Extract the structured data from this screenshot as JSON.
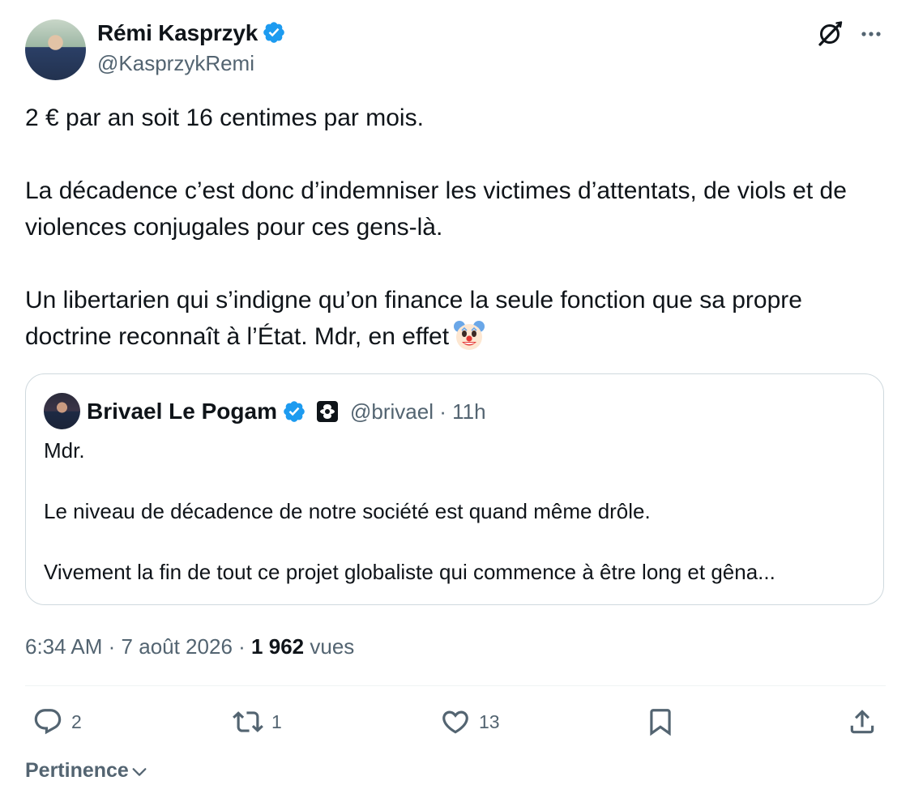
{
  "author": {
    "name": "Rémi Kasprzyk",
    "handle": "@KasprzykRemi"
  },
  "tweet_text": "2 € par an soit 16 centimes par mois.\n\nLa décadence c’est donc d’indemniser les victimes d’attentats, de viols et de violences conjugales pour ces gens-là.\n\nUn libertarien qui s’indigne qu’on finance la seule fonction que sa propre doctrine reconnaît à l’État. Mdr, en effet",
  "quoted": {
    "name": "Brivael Le Pogam",
    "handle": "@brivael",
    "separator": "·",
    "time": "11h",
    "text": "Mdr.\n\nLe niveau de décadence de notre société est quand même drôle.\n\nVivement la fin de tout ce projet globaliste qui commence à être long et gêna..."
  },
  "meta": {
    "time": "6:34 AM",
    "date": "7 août 2026",
    "separator": "·",
    "views_count": "1 962",
    "views_label": "vues"
  },
  "actions": {
    "reply_count": "2",
    "retweet_count": "1",
    "like_count": "13"
  },
  "sort": {
    "label": "Pertinence"
  },
  "icons": {
    "verified": "verified-badge-icon",
    "grok": "grok-icon",
    "more": "more-icon",
    "clown": "clown-emoji-icon",
    "reply": "reply-icon",
    "retweet": "retweet-icon",
    "like": "heart-icon",
    "bookmark": "bookmark-icon",
    "share": "share-icon"
  },
  "colors": {
    "text": "#0f1419",
    "secondary": "#536471",
    "verified": "#1d9bf0",
    "border": "#cfd9de"
  }
}
